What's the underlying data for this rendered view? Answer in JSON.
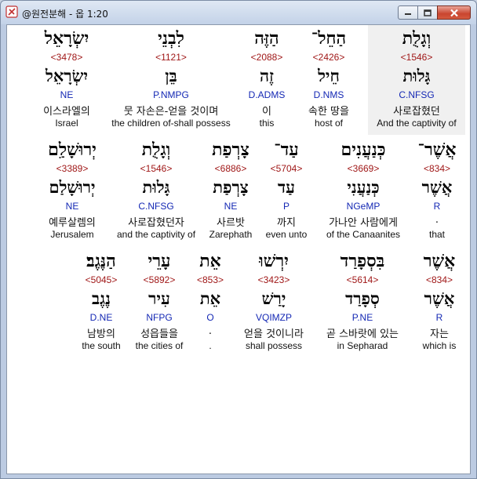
{
  "window": {
    "title": "@원전분해 - 옵 1:20",
    "buttons": [
      "minimize",
      "maximize",
      "close"
    ]
  },
  "rows": [
    {
      "words": [
        {
          "heb": "וְגָלֻת",
          "strong": "<1546>",
          "lex": "גָּלוּת",
          "parse": "C.NFSG",
          "korean": "사로잡혔던",
          "english": "And the captivity of",
          "highlighted": true
        },
        {
          "heb": "הַחֵל־",
          "strong": "<2426>",
          "lex": "חֵיל",
          "parse": "D.NMS",
          "korean": "속한 땅을",
          "english": "host of",
          "highlighted": false
        },
        {
          "heb": "הַזֶּה",
          "strong": "<2088>",
          "lex": "זֶה",
          "parse": "D.ADMS",
          "korean": "이",
          "english": "this",
          "highlighted": false
        },
        {
          "heb": "לִבְנֵי",
          "strong": "<1121>",
          "lex": "בֵּן",
          "parse": "P.NMPG",
          "korean": "뭇 자손은-얻을 것이며",
          "english": "the children of-shall possess",
          "highlighted": false
        },
        {
          "heb": "יִשְׂרָאֵל",
          "strong": "<3478>",
          "lex": "יִשְׂרָאֵל",
          "parse": "NE",
          "korean": "이스라엘의",
          "english": "Israel",
          "highlighted": false
        }
      ]
    },
    {
      "words": [
        {
          "heb": "אֲשֶׁר־",
          "strong": "<834>",
          "lex": "אֲשֶׁר",
          "parse": "R",
          "korean": ".",
          "english": "that",
          "highlighted": false
        },
        {
          "heb": "כְּנַעֲנִים",
          "strong": "<3669>",
          "lex": "כְּנַעֲנִי",
          "parse": "NGeMP",
          "korean": "가나안 사람에게",
          "english": "of the Canaanites",
          "highlighted": false
        },
        {
          "heb": "עַד־",
          "strong": "<5704>",
          "lex": "עַד",
          "parse": "P",
          "korean": "까지",
          "english": "even unto",
          "highlighted": false
        },
        {
          "heb": "צָרְפַת",
          "strong": "<6886>",
          "lex": "צָרְפַת",
          "parse": "NE",
          "korean": "사르밧",
          "english": "Zarephath",
          "highlighted": false
        },
        {
          "heb": "וְגָלֻת",
          "strong": "<1546>",
          "lex": "גָּלוּת",
          "parse": "C.NFSG",
          "korean": "사로잡혔던자",
          "english": "and the captivity of",
          "highlighted": false
        },
        {
          "heb": "יְרוּשָׁלִַם",
          "strong": "<3389>",
          "lex": "יְרוּשָׁלַם",
          "parse": "NE",
          "korean": "예루살렘의",
          "english": "Jerusalem",
          "highlighted": false
        }
      ]
    },
    {
      "words": [
        {
          "heb": "אֲשֶׁר",
          "strong": "<834>",
          "lex": "אֲשֶׁר",
          "parse": "R",
          "korean": "자는",
          "english": "which is",
          "highlighted": false
        },
        {
          "heb": "בִּסְפָרַד",
          "strong": "<5614>",
          "lex": "סְפָרַד",
          "parse": "P.NE",
          "korean": "곧 스바랏에 있는",
          "english": "in Sepharad",
          "highlighted": false
        },
        {
          "heb": "יִרְשׁוּ",
          "strong": "<3423>",
          "lex": "יָרַשׁ",
          "parse": "VQIMZP",
          "korean": "얻을 것이니라",
          "english": "shall possess",
          "highlighted": false
        },
        {
          "heb": "אֵת",
          "strong": "<853>",
          "lex": "אֵת",
          "parse": "O",
          "korean": ".",
          "english": ".",
          "highlighted": false
        },
        {
          "heb": "עָרֵי",
          "strong": "<5892>",
          "lex": "עִיר",
          "parse": "NFPG",
          "korean": "성읍들을",
          "english": "the cities of",
          "highlighted": false
        },
        {
          "heb": "הַנֶּגֶב׃",
          "strong": "<5045>",
          "lex": "נֶגֶב",
          "parse": "D.NE",
          "korean": "남방의",
          "english": "the south",
          "highlighted": false
        }
      ]
    }
  ]
}
